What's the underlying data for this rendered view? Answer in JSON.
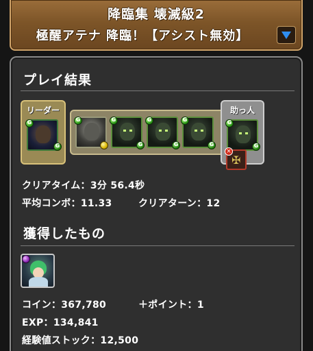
{
  "banner": {
    "title": "降臨集 壊滅級2",
    "dungeon": "極醒アテナ 降臨！【アシスト無効】",
    "dropdown_icon": "dropdown-arrow-icon"
  },
  "results": {
    "title": "プレイ結果",
    "team": {
      "leader_label": "リーダー",
      "helper_label": "助っ人",
      "leader_attribute": "green",
      "member_count": 4,
      "assist_disabled": true
    },
    "clear_time_label": "クリアタイム：",
    "clear_time_value": "3分 56.4秒",
    "avg_combo_label": "平均コンボ：",
    "avg_combo_value": "11.33",
    "clear_turn_label": "クリアターン：",
    "clear_turn_value": "12"
  },
  "rewards": {
    "title": "獲得したもの",
    "coin_label": "コイン：",
    "coin_value": "367,780",
    "points_label": "＋ポイント：",
    "points_value": "1",
    "exp_label": "EXP：",
    "exp_value": "134,841",
    "stock_label": "経験値ストック：",
    "stock_value": "12,500"
  },
  "colors": {
    "banner": "#7d5528",
    "panel": "#2f2f2f",
    "leader_frame": "#d9c27a",
    "dropdown_arrow": "#2f8df0"
  }
}
